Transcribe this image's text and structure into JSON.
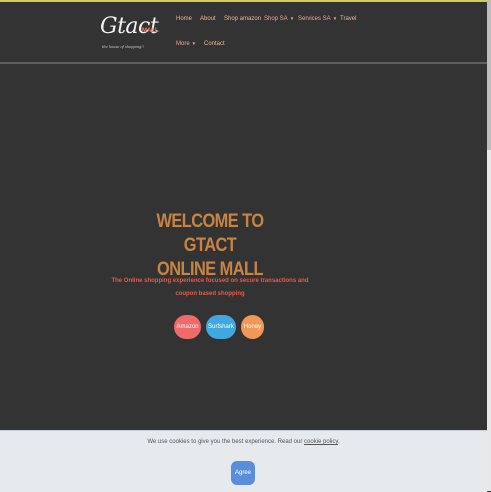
{
  "header": {
    "logo": {
      "script": "Gtact",
      "mall": "MALL",
      "tagline": "the house of shopping!!"
    },
    "nav": [
      {
        "label": "Home"
      },
      {
        "label": "About"
      },
      {
        "label": "Shop amazon"
      },
      {
        "label": "Shop SA",
        "dropdown": true
      },
      {
        "label": "Services SA",
        "dropdown": true
      },
      {
        "label": "Travel"
      },
      {
        "label": "More",
        "dropdown": true
      },
      {
        "label": "Contact"
      }
    ]
  },
  "hero": {
    "title_line1": "WELCOME TO GTACT",
    "title_line2": "ONLINE MALL",
    "subtitle_line1": "The Online shopping experience focused on secure transactions and",
    "subtitle_line2": "coupon based shopping",
    "buttons": [
      {
        "label": "Amazon",
        "color": "#f06a6a"
      },
      {
        "label": "Surfshark",
        "color": "#3fa8e0"
      },
      {
        "label": "Honey",
        "color": "#f19858"
      }
    ]
  },
  "cookie": {
    "text": "We use cookies to give you the best experience. Read our",
    "link": "cookie policy",
    "suffix": ".",
    "agree": "Agree"
  },
  "colors": {
    "background": "#333333",
    "title": "#c98443",
    "subtitle": "#e55a4a",
    "nav_text": "#f0b79a"
  }
}
